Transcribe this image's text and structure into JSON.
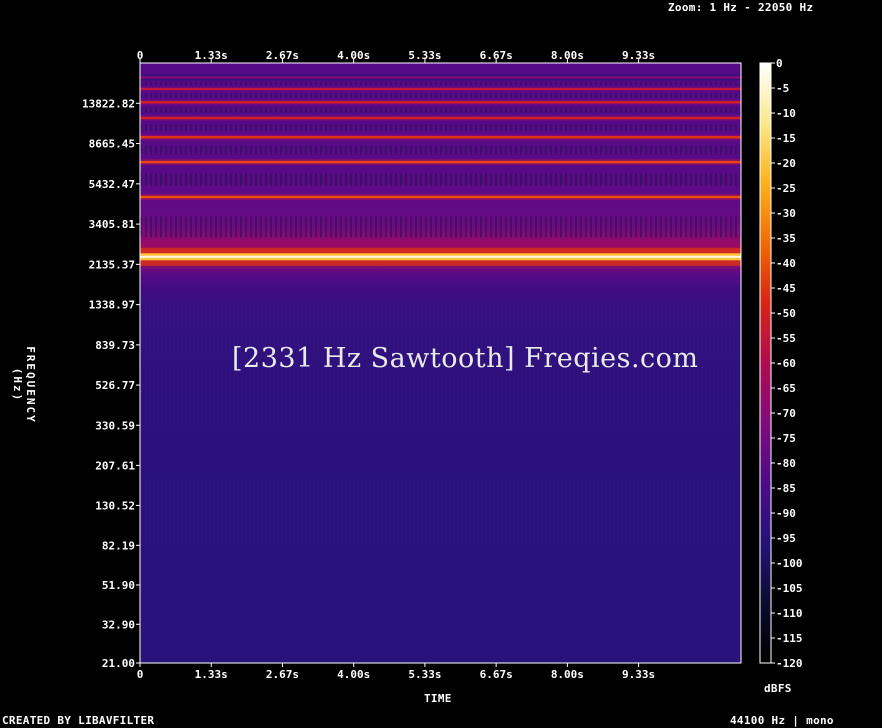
{
  "header": {
    "zoom": "Zoom: 1 Hz - 22050 Hz"
  },
  "footer": {
    "created_by": "CREATED BY LIBAVFILTER",
    "sample_info": "44100 Hz | mono"
  },
  "watermark": "[2331 Hz Sawtooth] Freqies.com",
  "chart_data": {
    "type": "heatmap",
    "title": "",
    "xlabel": "TIME",
    "ylabel": "FREQUENCY (Hz)",
    "colorbar_label": "dBFS",
    "x_ticks": [
      "0",
      "1.33s",
      "2.67s",
      "4.00s",
      "5.33s",
      "6.67s",
      "8.00s",
      "9.33s"
    ],
    "x_range_seconds": [
      0,
      11.25
    ],
    "y_scale": "log",
    "y_range_hz": [
      21.0,
      22050
    ],
    "y_ticks": [
      21.0,
      32.9,
      51.9,
      82.19,
      130.52,
      207.61,
      330.59,
      526.77,
      839.73,
      1338.97,
      2135.37,
      3405.81,
      5432.47,
      8665.45,
      13822.82
    ],
    "y_tick_labels": [
      "21.00",
      "32.90",
      "51.90",
      "82.19",
      "130.52",
      "207.61",
      "330.59",
      "526.77",
      "839.73",
      "1338.97",
      "2135.37",
      "3405.81",
      "5432.47",
      "8665.45",
      "13822.82"
    ],
    "colorbar_ticks": [
      0,
      -5,
      -10,
      -15,
      -20,
      -25,
      -30,
      -35,
      -40,
      -45,
      -50,
      -55,
      -60,
      -65,
      -70,
      -75,
      -80,
      -85,
      -90,
      -95,
      -100,
      -105,
      -110,
      -115,
      -120
    ],
    "colorbar_range_dbfs": [
      -120,
      0
    ],
    "background_level_dbfs": -95,
    "harmonics": [
      {
        "freq_hz": 2331,
        "level_dbfs": -20
      },
      {
        "freq_hz": 4662,
        "level_dbfs": -40
      },
      {
        "freq_hz": 6993,
        "level_dbfs": -42
      },
      {
        "freq_hz": 9324,
        "level_dbfs": -45
      },
      {
        "freq_hz": 11655,
        "level_dbfs": -50
      },
      {
        "freq_hz": 13986,
        "level_dbfs": -50
      },
      {
        "freq_hz": 16317,
        "level_dbfs": -55
      },
      {
        "freq_hz": 18648,
        "level_dbfs": -70
      }
    ],
    "colormap": [
      "#000000",
      "#0c0a30",
      "#24127a",
      "#4e0a8a",
      "#800a7c",
      "#b00c50",
      "#d82414",
      "#f26a04",
      "#fbb21a",
      "#fce88a",
      "#ffffff"
    ]
  }
}
